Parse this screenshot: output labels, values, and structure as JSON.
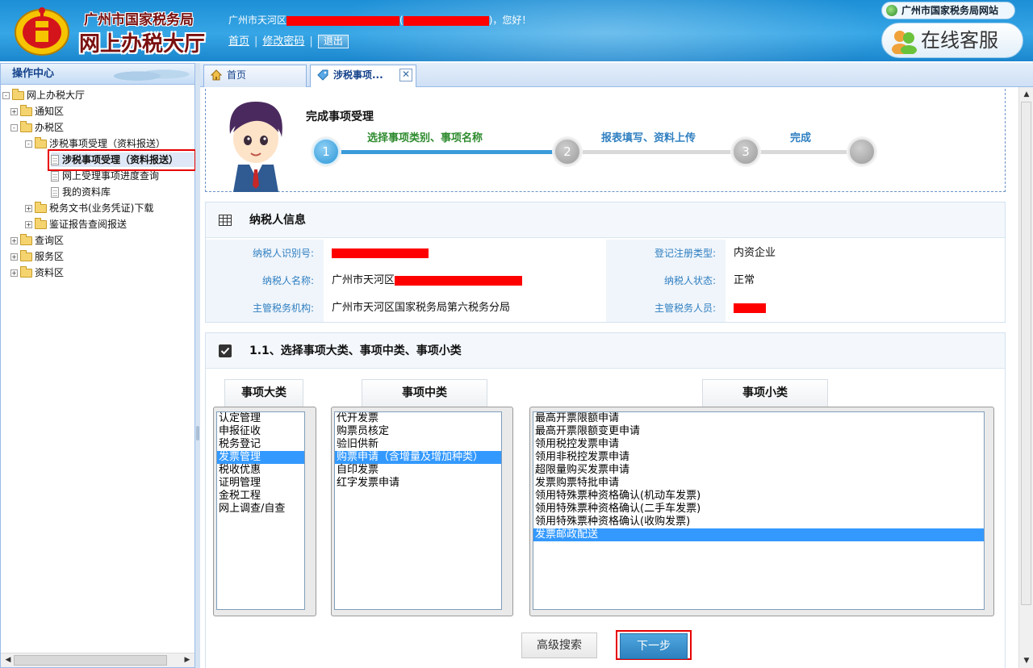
{
  "header": {
    "bureau_name": "广州市国家税务局",
    "hall_name": "网上办税大厅",
    "greeting_prefix": "广州市天河区",
    "greeting_mid": "(",
    "greeting_suffix": ")，您好！",
    "home_link": "首页",
    "change_password_link": "修改密码",
    "logout_label": "退出",
    "site_link": "广州市国家税务局网站",
    "service_label": "在线客服"
  },
  "sidebar": {
    "title": "操作中心",
    "items": [
      {
        "label": "网上办税大厅",
        "level": 0,
        "type": "folder",
        "toggle": "-"
      },
      {
        "label": "通知区",
        "level": 1,
        "type": "folder",
        "toggle": "+"
      },
      {
        "label": "办税区",
        "level": 1,
        "type": "folder",
        "toggle": "-"
      },
      {
        "label": "涉税事项受理（资料报送）",
        "level": 2,
        "type": "folder",
        "toggle": "-"
      },
      {
        "label": "涉税事项受理（资料报送）",
        "level": 3,
        "type": "doc",
        "selected": true
      },
      {
        "label": "网上受理事项进度查询",
        "level": 3,
        "type": "doc"
      },
      {
        "label": "我的资料库",
        "level": 3,
        "type": "doc"
      },
      {
        "label": "税务文书(业务凭证)下载",
        "level": 2,
        "type": "folder",
        "toggle": "+"
      },
      {
        "label": "鉴证报告查阅报送",
        "level": 2,
        "type": "folder",
        "toggle": "+"
      },
      {
        "label": "查询区",
        "level": 1,
        "type": "folder",
        "toggle": "+"
      },
      {
        "label": "服务区",
        "level": 1,
        "type": "folder",
        "toggle": "+"
      },
      {
        "label": "资料区",
        "level": 1,
        "type": "folder",
        "toggle": "+"
      }
    ]
  },
  "tabs": [
    {
      "label": "首页",
      "active": false
    },
    {
      "label": "涉税事项...",
      "active": true
    }
  ],
  "progress": {
    "title": "完成事项受理",
    "steps": [
      {
        "number": "1",
        "label": "选择事项类别、事项名称",
        "state": "active"
      },
      {
        "number": "2",
        "label": "报表填写、资料上传",
        "state": "pending"
      },
      {
        "number": "3",
        "label": "完成",
        "state": "pending"
      },
      {
        "number": "",
        "label": "",
        "state": "pending"
      }
    ]
  },
  "taxpayer": {
    "title": "纳税人信息",
    "taxpayer_id_label": "纳税人识别号:",
    "taxpayer_id_value": "",
    "reg_type_label": "登记注册类型:",
    "reg_type_value": "内资企业",
    "name_label": "纳税人名称:",
    "name_value": "广州市天河区",
    "status_label": "纳税人状态:",
    "status_value": "正常",
    "authority_label": "主管税务机构:",
    "authority_value": "广州市天河区国家税务局第六税务分局",
    "officer_label": "主管税务人员:",
    "officer_value": ""
  },
  "selection": {
    "title": "1.1、选择事项大类、事项中类、事项小类",
    "major_title": "事项大类",
    "middle_title": "事项中类",
    "minor_title": "事项小类",
    "major_items": [
      "认定管理",
      "申报征收",
      "税务登记",
      "发票管理",
      "税收优惠",
      "证明管理",
      "金税工程",
      "网上调查/自查"
    ],
    "major_selected": 3,
    "middle_items": [
      "代开发票",
      "购票员核定",
      "验旧供新",
      "购票申请（含增量及增加种类）",
      "自印发票",
      "红字发票申请"
    ],
    "middle_selected": 3,
    "minor_items": [
      "最高开票限额申请",
      "最高开票限额变更申请",
      "领用税控发票申请",
      "领用非税控发票申请",
      "超限量购买发票申请",
      "发票购票特批申请",
      "领用特殊票种资格确认(机动车发票)",
      "领用特殊票种资格确认(二手车发票)",
      "领用特殊票种资格确认(收购发票)",
      "发票邮政配送"
    ],
    "minor_selected": 9
  },
  "buttons": {
    "advanced_search": "高级搜索",
    "next": "下一步"
  },
  "colors": {
    "header_blue": "#2a97db",
    "link_blue": "#2f7fc1",
    "selection_blue": "#3399ff",
    "highlight_red": "#e60000"
  }
}
